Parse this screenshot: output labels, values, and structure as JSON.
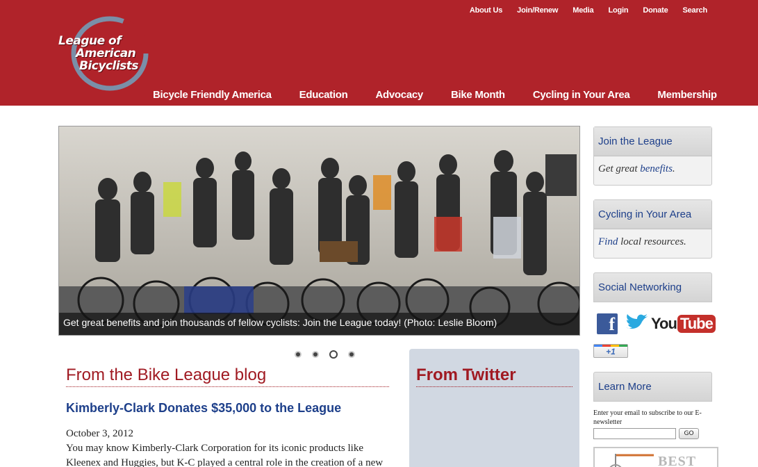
{
  "utility_nav": [
    "About Us",
    "Join/Renew",
    "Media",
    "Login",
    "Donate",
    "Search"
  ],
  "logo": {
    "line1": "League of",
    "line2": "American",
    "line3": "Bicyclists"
  },
  "main_nav": [
    "Bicycle Friendly America",
    "Education",
    "Advocacy",
    "Bike Month",
    "Cycling in Your Area",
    "Membership"
  ],
  "slideshow": {
    "caption": "Get great benefits and join thousands of fellow cyclists: Join the League today! (Photo: Leslie Bloom)",
    "slide_count": 4,
    "active_slide": 3
  },
  "blog": {
    "heading": "From the Bike League blog",
    "post_title": "Kimberly-Clark Donates $35,000 to the League",
    "post_date": "October 3, 2012",
    "post_excerpt_line1": "You may know Kimberly-Clark Corporation for its iconic products like",
    "post_excerpt_line2": "Kleenex and Huggies, but K-C played a central role in the creation of a new"
  },
  "twitter": {
    "heading": "From Twitter"
  },
  "sidebar": {
    "join": {
      "title": "Join the League",
      "body_prefix": "Get great ",
      "body_link": "benefits",
      "body_suffix": "."
    },
    "cycling": {
      "title": "Cycling in Your Area",
      "body_link": "Find",
      "body_suffix": " local resources."
    },
    "social": {
      "title": "Social Networking",
      "facebook": "f",
      "youtube_you": "You",
      "youtube_tube": "Tube",
      "gplus": "+1"
    },
    "learn_more": {
      "title": "Learn More"
    },
    "newsletter_label": "Enter your email to subscribe to our E-newsletter",
    "go_label": "GO",
    "ad_text": "BEST"
  },
  "colors": {
    "header_red": "#b0232a",
    "link_blue": "#1d3f8a",
    "heading_red": "#a01a22"
  }
}
